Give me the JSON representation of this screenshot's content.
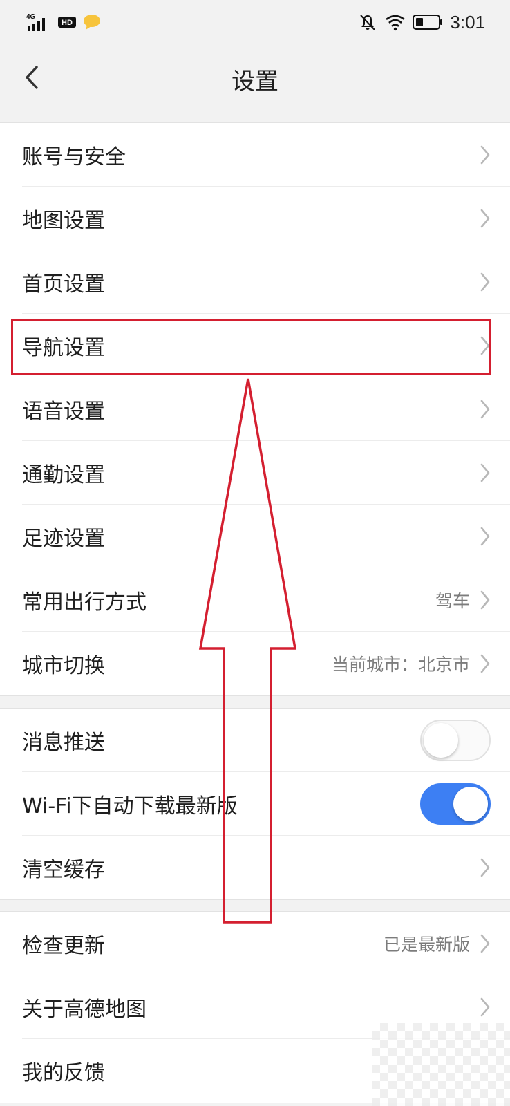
{
  "status_bar": {
    "network": "4G",
    "hd": "HD",
    "time": "3:01"
  },
  "header": {
    "title": "设置"
  },
  "group1": {
    "items": [
      {
        "label": "账号与安全"
      },
      {
        "label": "地图设置"
      },
      {
        "label": "首页设置"
      },
      {
        "label": "导航设置"
      },
      {
        "label": "语音设置"
      },
      {
        "label": "通勤设置"
      },
      {
        "label": "足迹设置"
      },
      {
        "label": "常用出行方式",
        "value": "驾车"
      },
      {
        "label": "城市切换",
        "value": "当前城市：北京市"
      }
    ]
  },
  "group2": {
    "items": [
      {
        "label": "消息推送",
        "toggle": false
      },
      {
        "label": "Wi-Fi下自动下载最新版",
        "toggle": true
      },
      {
        "label": "清空缓存"
      }
    ]
  },
  "group3": {
    "items": [
      {
        "label": "检查更新",
        "value": "已是最新版"
      },
      {
        "label": "关于高德地图"
      },
      {
        "label": "我的反馈"
      }
    ]
  },
  "colors": {
    "highlight": "#d41f30",
    "toggle_on": "#3d7ff3",
    "chevron": "#b8b8b8"
  }
}
